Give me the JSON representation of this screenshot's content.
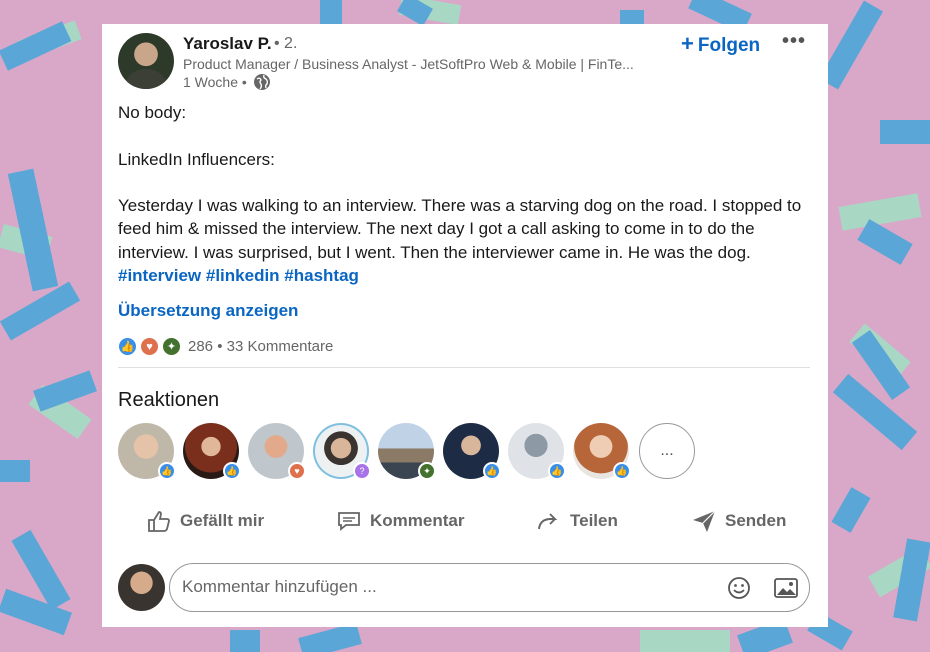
{
  "post": {
    "author": {
      "name": "Yaroslav P.",
      "degree": "• 2.",
      "headline": "Product Manager / Business Analyst - JetSoftPro Web & Mobile | FinTe...",
      "age": "1 Woche •"
    },
    "follow_label": "Folgen",
    "more_label": "•••",
    "body": {
      "line1": "No body:",
      "line2": "LinkedIn Influencers:",
      "line3": "Yesterday I was walking to an interview. There was a starving dog on the road. I stopped to feed him & missed the interview. The next day I got a call asking to come in to do the interview. I was surprised, but I went. Then the interviewer came in. He was the dog.",
      "hashtags": "#interview #linkedin #hashtag"
    },
    "translate_label": "Übersetzung anzeigen",
    "social_counts": {
      "reactions": "286",
      "separator": "•",
      "comments": "33 Kommentare"
    },
    "reactions_title": "Reaktionen",
    "more_reactors_label": "...",
    "reactors": [
      {
        "reaction": "like-icon"
      },
      {
        "reaction": "like-icon"
      },
      {
        "reaction": "love-icon"
      },
      {
        "reaction": "curious-icon"
      },
      {
        "reaction": "insightful-icon"
      },
      {
        "reaction": "like-icon"
      },
      {
        "reaction": "like-icon"
      },
      {
        "reaction": "like-icon"
      }
    ],
    "actions": {
      "like": "Gefällt mir",
      "comment": "Kommentar",
      "share": "Teilen",
      "send": "Senden"
    },
    "comment_input": {
      "placeholder": "Kommentar hinzufügen ..."
    }
  },
  "colors": {
    "link_blue": "#0a66c2",
    "background_pink": "#d9a8c8",
    "background_mint": "#a8d8c4",
    "background_blue": "#5aa6d6"
  }
}
